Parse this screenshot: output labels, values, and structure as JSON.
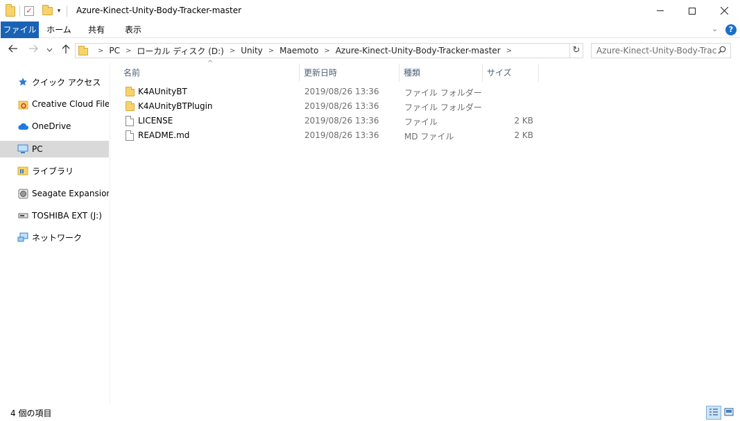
{
  "window": {
    "title": "Azure-Kinect-Unity-Body-Tracker-master",
    "minimize": "─",
    "maximize": "□",
    "close": "✕"
  },
  "ribbon": {
    "tabs": [
      "ファイル",
      "ホーム",
      "共有",
      "表示"
    ],
    "help": "?"
  },
  "nav": {
    "breadcrumb": [
      "PC",
      "ローカル ディスク (D:)",
      "Unity",
      "Maemoto",
      "Azure-Kinect-Unity-Body-Tracker-master"
    ],
    "search_placeholder": "Azure-Kinect-Unity-Body-Trac..."
  },
  "sidebar": {
    "items": [
      {
        "label": "クイック アクセス",
        "icon": "star-icon"
      },
      {
        "label": "Creative Cloud Files",
        "icon": "creative-cloud-icon"
      },
      {
        "label": "OneDrive",
        "icon": "cloud-icon"
      },
      {
        "label": "PC",
        "icon": "computer-icon",
        "selected": true
      },
      {
        "label": "ライブラリ",
        "icon": "library-icon"
      },
      {
        "label": "Seagate Expansion Dr",
        "icon": "hard-drive-icon"
      },
      {
        "label": "TOSHIBA EXT (J:)",
        "icon": "usb-drive-icon"
      },
      {
        "label": "ネットワーク",
        "icon": "network-icon"
      }
    ]
  },
  "columns": {
    "name": "名前",
    "date": "更新日時",
    "type": "種類",
    "size": "サイズ"
  },
  "files": [
    {
      "name": "K4AUnityBT",
      "date": "2019/08/26 13:36",
      "type": "ファイル フォルダー",
      "size": "",
      "kind": "folder"
    },
    {
      "name": "K4AUnityBTPlugin",
      "date": "2019/08/26 13:36",
      "type": "ファイル フォルダー",
      "size": "",
      "kind": "folder"
    },
    {
      "name": "LICENSE",
      "date": "2019/08/26 13:36",
      "type": "ファイル",
      "size": "2 KB",
      "kind": "file"
    },
    {
      "name": "README.md",
      "date": "2019/08/26 13:36",
      "type": "MD ファイル",
      "size": "2 KB",
      "kind": "file"
    }
  ],
  "status": {
    "item_count": "4 個の項目"
  },
  "colors": {
    "accent": "#1a63b4",
    "selected_bg": "#d9d9d9",
    "header_text": "#4c607a"
  }
}
